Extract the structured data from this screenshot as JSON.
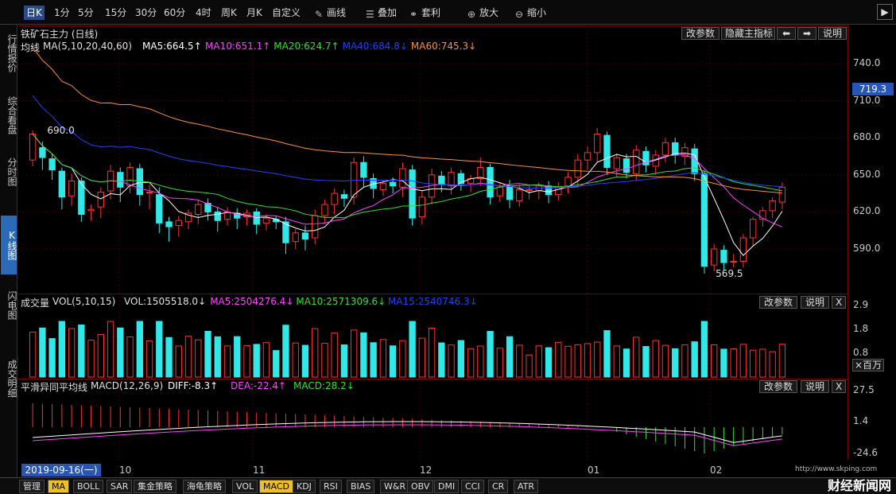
{
  "toolbar": {
    "items": [
      "日K",
      "1分",
      "5分",
      "15分",
      "30分",
      "60分",
      "4时",
      "周K",
      "月K",
      "自定义",
      "画线",
      "叠加",
      "套利",
      "放大",
      "缩小"
    ]
  },
  "side": {
    "items": [
      "行情报价",
      "综合看盘",
      "分时图",
      "K线图",
      "闪电图",
      "成交明细"
    ]
  },
  "title": "铁矿石主力 (日线)",
  "buttons": {
    "params": "改参数",
    "hide": "隐藏主指标",
    "explain": "说明",
    "close": "X"
  },
  "ma": {
    "name": "均线",
    "params": "MA(5,10,20,40,60)",
    "items": [
      {
        "t": "MA5:664.5↑",
        "c": "#ffffff"
      },
      {
        "t": "MA10:651.1↑",
        "c": "#ff40ff"
      },
      {
        "t": "MA20:624.7↑",
        "c": "#30e030"
      },
      {
        "t": "MA40:684.8↓",
        "c": "#2040ff"
      },
      {
        "t": "MA60:745.3↓",
        "c": "#ff9030"
      }
    ]
  },
  "vol": {
    "name": "成交量",
    "params": "VOL(5,10,15)",
    "items": [
      {
        "t": "VOL:1505518.0↓",
        "c": "#e0e0e0"
      },
      {
        "t": "MA5:2504276.4↓",
        "c": "#ff40ff"
      },
      {
        "t": "MA10:2571309.6↓",
        "c": "#30e030"
      },
      {
        "t": "MA15:2540746.3↓",
        "c": "#2040ff"
      }
    ],
    "unit": "×百万"
  },
  "macd": {
    "name": "平滑异同平均线",
    "params": "MACD(12,26,9)",
    "items": [
      {
        "t": "DIFF:-8.3↑",
        "c": "#ffffff"
      },
      {
        "t": "DEA:-22.4↑",
        "c": "#ff40ff"
      },
      {
        "t": "MACD:28.2↓",
        "c": "#30e030"
      }
    ]
  },
  "price_axis": [
    "740.0",
    "710.0",
    "680.0",
    "650.0",
    "620.0",
    "590.0"
  ],
  "current_price": "719.3",
  "vol_axis": [
    "2.9",
    "1.8",
    "0.8"
  ],
  "macd_axis": [
    "27.5",
    "1.4",
    "-24.6"
  ],
  "annot": {
    "high": "690.0",
    "low": "569.5"
  },
  "dates": {
    "selected": "2019-09-16(一)",
    "labels": [
      "10",
      "11",
      "12",
      "01",
      "02"
    ]
  },
  "tabs": [
    "管理",
    "MA",
    "BOLL",
    "SAR",
    "集金策略",
    "海龟策略",
    "VOL",
    "MACD",
    "KDJ",
    "RSI",
    "BIAS",
    "W&R",
    "OBV",
    "DMI",
    "CCI",
    "CR",
    "ATR"
  ],
  "watermark": {
    "name": "财经新闻网",
    "url": "http://www.skping.com"
  },
  "chart_data": {
    "type": "candlestick",
    "series_ma": [
      {
        "name": "MA5"
      },
      {
        "name": "MA10"
      },
      {
        "name": "MA20"
      },
      {
        "name": "MA40"
      },
      {
        "name": "MA60"
      }
    ],
    "candles": [
      [
        662,
        683,
        660,
        686,
        657
      ],
      [
        672,
        664,
        657,
        677,
        654
      ],
      [
        663,
        654,
        650,
        667,
        646
      ],
      [
        653,
        632,
        626,
        656,
        622
      ],
      [
        633,
        645,
        628,
        651,
        625
      ],
      [
        645,
        618,
        615,
        648,
        612
      ],
      [
        621,
        622,
        617,
        626,
        613
      ],
      [
        624,
        636,
        619,
        640,
        615
      ],
      [
        637,
        653,
        634,
        658,
        630
      ],
      [
        652,
        640,
        632,
        656,
        628
      ],
      [
        641,
        656,
        638,
        660,
        635
      ],
      [
        655,
        634,
        629,
        659,
        625
      ],
      [
        636,
        636,
        627,
        642,
        622
      ],
      [
        634,
        611,
        606,
        640,
        603
      ],
      [
        612,
        608,
        601,
        616,
        596
      ],
      [
        609,
        613,
        604,
        617,
        600
      ],
      [
        612,
        619,
        609,
        622,
        606
      ],
      [
        618,
        626,
        614,
        630,
        610
      ],
      [
        627,
        620,
        616,
        631,
        613
      ],
      [
        620,
        613,
        608,
        624,
        604
      ],
      [
        614,
        620,
        611,
        624,
        609
      ],
      [
        619,
        615,
        610,
        623,
        606
      ],
      [
        616,
        619,
        612,
        622,
        609
      ],
      [
        620,
        610,
        605,
        623,
        602
      ],
      [
        611,
        615,
        608,
        618,
        605
      ],
      [
        614,
        612,
        609,
        617,
        606
      ],
      [
        612,
        595,
        590,
        616,
        586
      ],
      [
        596,
        603,
        593,
        606,
        590
      ],
      [
        603,
        598,
        592,
        609,
        589
      ],
      [
        599,
        617,
        596,
        622,
        594
      ],
      [
        617,
        626,
        614,
        630,
        611
      ],
      [
        626,
        635,
        621,
        639,
        618
      ],
      [
        634,
        631,
        627,
        638,
        624
      ],
      [
        632,
        660,
        629,
        664,
        626
      ],
      [
        660,
        648,
        643,
        665,
        640
      ],
      [
        647,
        639,
        634,
        651,
        631
      ],
      [
        638,
        643,
        635,
        646,
        633
      ],
      [
        644,
        641,
        638,
        648,
        635
      ],
      [
        640,
        655,
        637,
        660,
        632
      ],
      [
        654,
        615,
        612,
        658,
        609
      ],
      [
        616,
        632,
        614,
        637,
        610
      ],
      [
        632,
        650,
        629,
        655,
        626
      ],
      [
        649,
        642,
        639,
        653,
        636
      ],
      [
        641,
        652,
        638,
        656,
        634
      ],
      [
        651,
        643,
        640,
        654,
        637
      ],
      [
        643,
        647,
        640,
        650,
        636
      ],
      [
        647,
        656,
        644,
        664,
        641
      ],
      [
        656,
        632,
        629,
        659,
        626
      ],
      [
        633,
        640,
        630,
        644,
        628
      ],
      [
        641,
        630,
        626,
        646,
        623
      ],
      [
        629,
        638,
        627,
        642,
        624
      ],
      [
        638,
        638,
        633,
        641,
        630
      ],
      [
        637,
        641,
        633,
        644,
        630
      ],
      [
        641,
        634,
        630,
        645,
        627
      ],
      [
        634,
        640,
        631,
        644,
        629
      ],
      [
        641,
        648,
        638,
        652,
        635
      ],
      [
        648,
        662,
        644,
        667,
        640
      ],
      [
        662,
        668,
        658,
        673,
        654
      ],
      [
        668,
        683,
        664,
        688,
        660
      ],
      [
        682,
        656,
        653,
        685,
        650
      ],
      [
        655,
        664,
        652,
        667,
        648
      ],
      [
        663,
        652,
        650,
        667,
        647
      ],
      [
        651,
        670,
        648,
        674,
        645
      ],
      [
        669,
        658,
        655,
        673,
        652
      ],
      [
        657,
        666,
        652,
        670,
        650
      ],
      [
        666,
        676,
        663,
        680,
        660
      ],
      [
        676,
        666,
        662,
        680,
        659
      ],
      [
        665,
        672,
        661,
        676,
        658
      ],
      [
        671,
        651,
        648,
        675,
        645
      ],
      [
        651,
        576,
        572,
        654,
        570
      ],
      [
        577,
        590,
        575,
        594,
        572
      ],
      [
        589,
        579,
        575,
        593,
        573
      ],
      [
        580,
        580,
        577,
        586,
        575
      ],
      [
        580,
        599,
        578,
        602,
        575
      ],
      [
        599,
        614,
        596,
        616,
        592
      ],
      [
        614,
        621,
        612,
        624,
        608
      ],
      [
        621,
        629,
        618,
        632,
        615
      ],
      [
        628,
        640,
        625,
        644,
        622
      ]
    ]
  }
}
